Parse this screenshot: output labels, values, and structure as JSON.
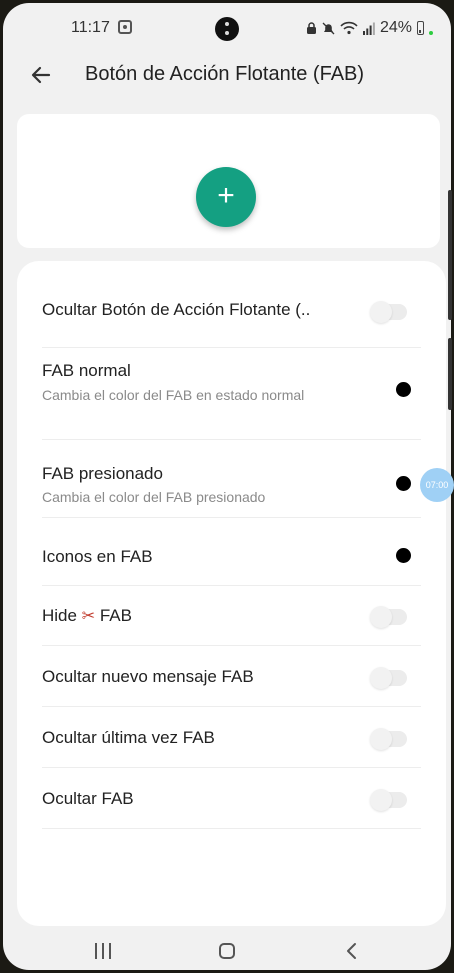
{
  "status_bar": {
    "time": "11:17",
    "battery": "24%"
  },
  "app_bar": {
    "title": "Botón de Acción Flotante (FAB)"
  },
  "preview": {
    "fab_symbol": "+",
    "fab_color": "#14a082"
  },
  "settings": {
    "hide_fab_button": {
      "title": "Ocultar Botón de Acción Flotante (..",
      "enabled": false
    },
    "fab_normal": {
      "title": "FAB normal",
      "subtitle": "Cambia el color del FAB en estado normal",
      "color": "#000000"
    },
    "fab_pressed": {
      "title": "FAB presionado",
      "subtitle": "Cambia el color del FAB presionado",
      "color": "#000000"
    },
    "fab_icons": {
      "title": "Iconos en FAB",
      "color": "#000000"
    },
    "hide_scissors_fab": {
      "title_before": "Hide",
      "title_after": "FAB",
      "enabled": false
    },
    "hide_new_message_fab": {
      "title": "Ocultar nuevo mensaje FAB",
      "enabled": false
    },
    "hide_last_seen_fab": {
      "title": "Ocultar última vez FAB",
      "enabled": false
    },
    "hide_fab": {
      "title": "Ocultar FAB",
      "enabled": false
    }
  },
  "floating_bubble": {
    "label": "07:00"
  }
}
